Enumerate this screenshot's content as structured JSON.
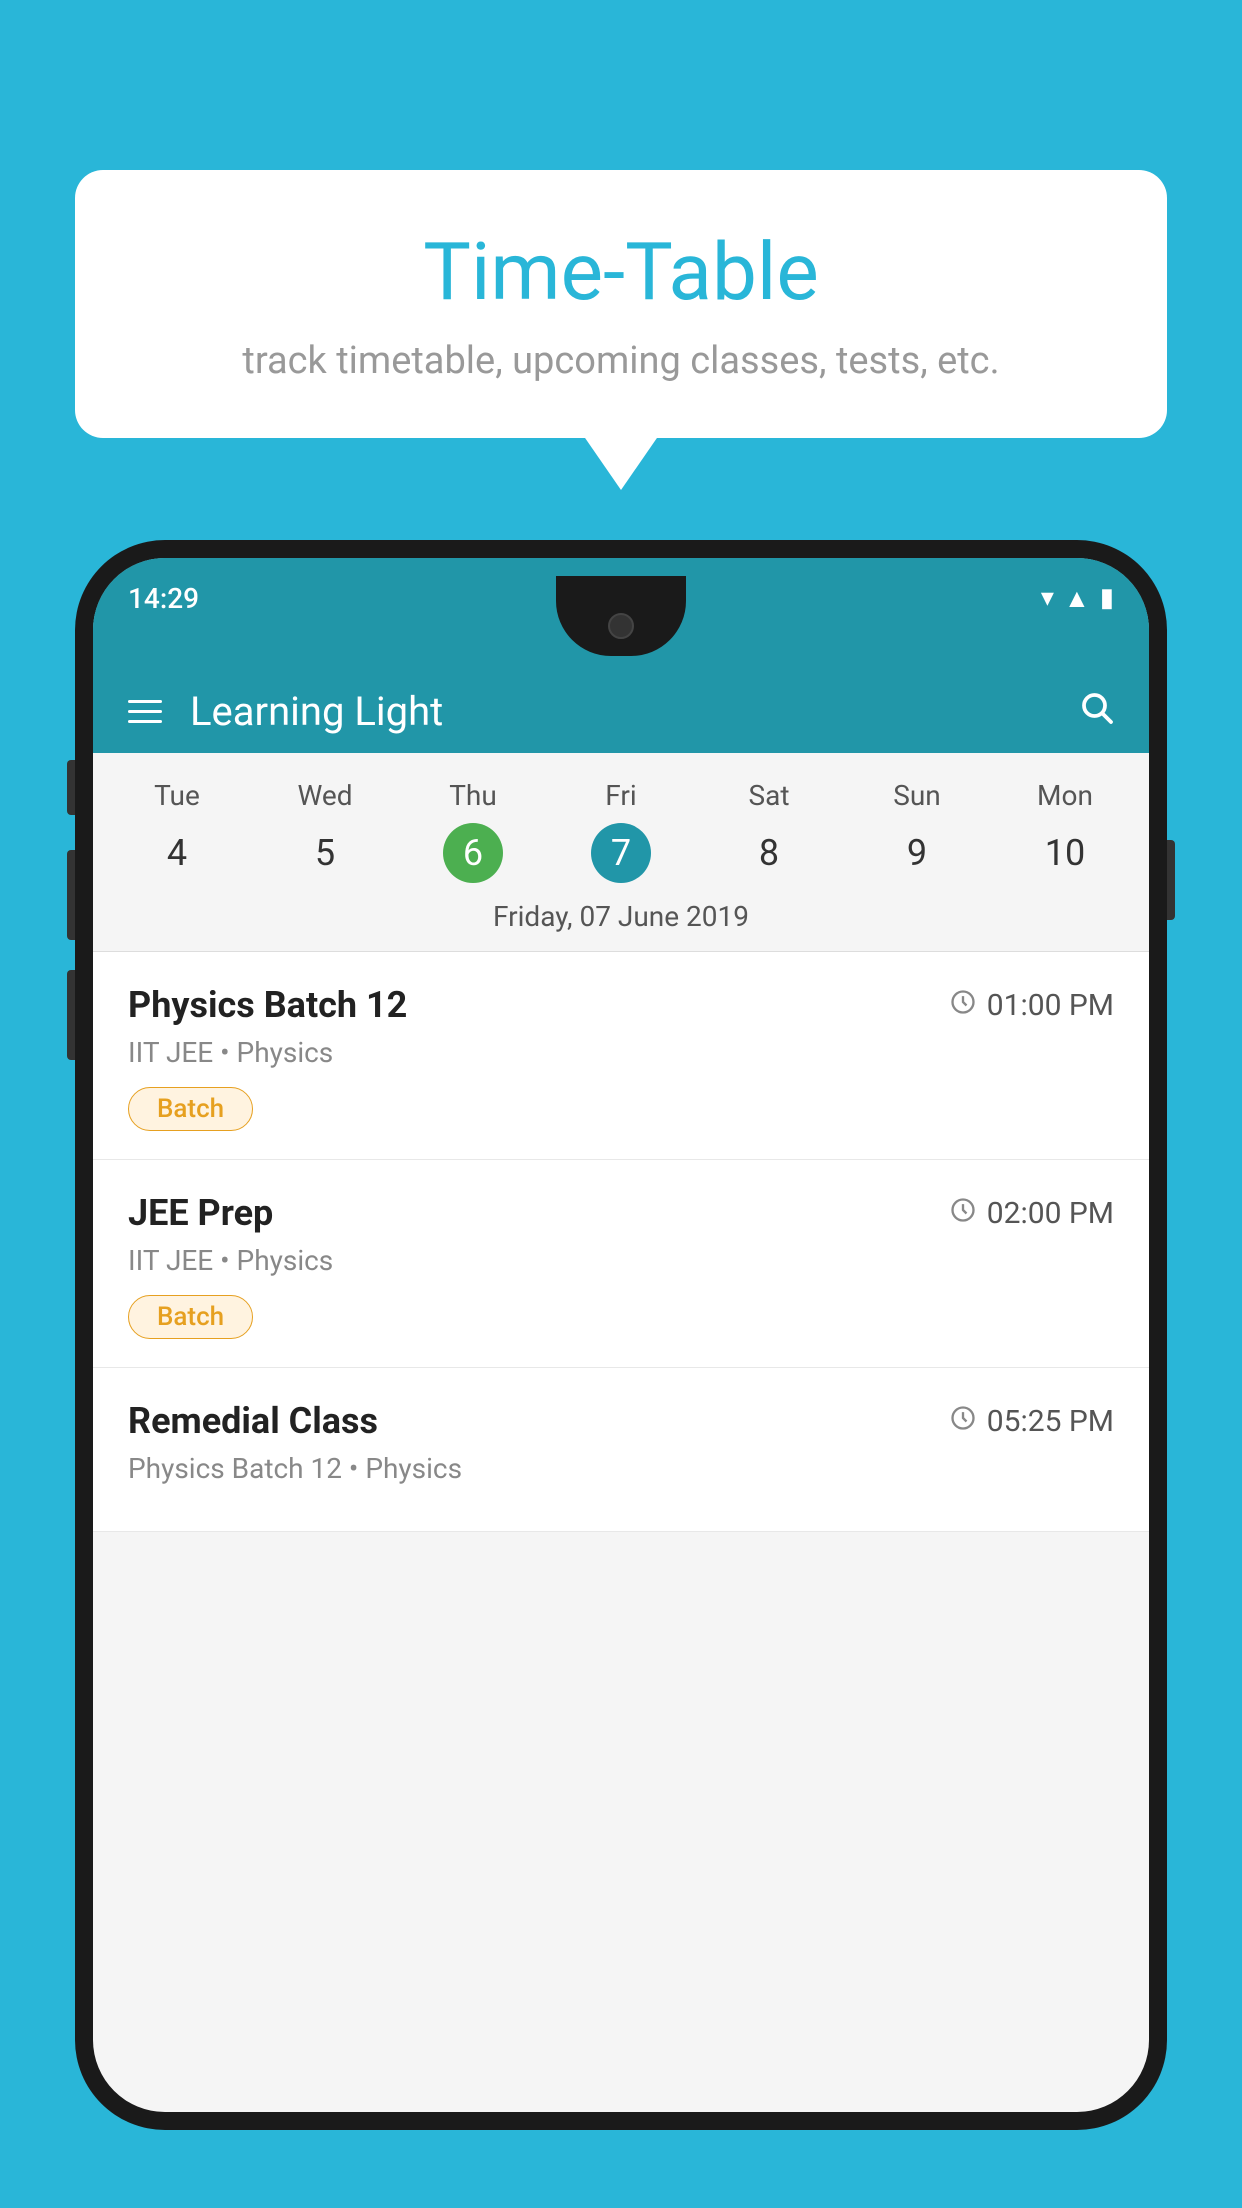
{
  "background_color": "#29B6D8",
  "bubble": {
    "title": "Time-Table",
    "subtitle": "track timetable, upcoming classes, tests, etc."
  },
  "phone": {
    "status_bar": {
      "time": "14:29"
    },
    "app_bar": {
      "title": "Learning Light",
      "menu_icon": "hamburger-icon",
      "search_icon": "search-icon"
    },
    "calendar": {
      "days": [
        "Tue",
        "Wed",
        "Thu",
        "Fri",
        "Sat",
        "Sun",
        "Mon"
      ],
      "dates": [
        "4",
        "5",
        "6",
        "7",
        "8",
        "9",
        "10"
      ],
      "today_index": 2,
      "selected_index": 3,
      "selected_date_label": "Friday, 07 June 2019"
    },
    "classes": [
      {
        "name": "Physics Batch 12",
        "time": "01:00 PM",
        "subject": "IIT JEE • Physics",
        "badge": "Batch"
      },
      {
        "name": "JEE Prep",
        "time": "02:00 PM",
        "subject": "IIT JEE • Physics",
        "badge": "Batch"
      },
      {
        "name": "Remedial Class",
        "time": "05:25 PM",
        "subject": "Physics Batch 12 • Physics",
        "badge": null
      }
    ]
  }
}
